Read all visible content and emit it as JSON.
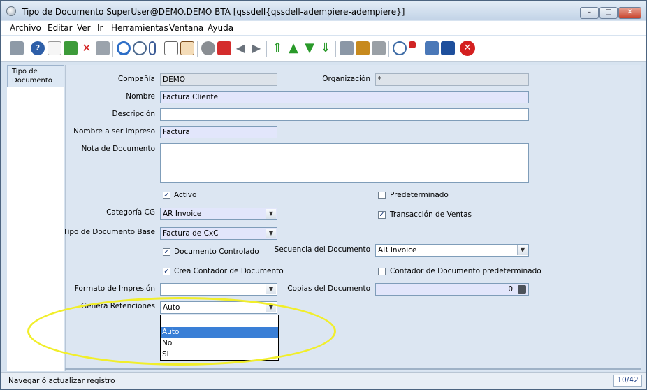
{
  "window": {
    "title": "Tipo de Documento  SuperUser@DEMO.DEMO BTA [qssdell{qssdell-adempiere-adempiere}]",
    "min_label": "–",
    "max_label": "□",
    "close_label": "✕"
  },
  "menu": [
    "Archivo",
    "Editar",
    "Ver",
    "Ir",
    "Herramientas",
    "Ventana",
    "Ayuda"
  ],
  "toolbar": {
    "icons": [
      "undo-icon",
      "help-icon",
      "new-icon",
      "save-new-icon",
      "delete-icon",
      "save-icon",
      "refresh-icon",
      "find-icon",
      "attachment-icon",
      "chat-icon",
      "grid-toggle-icon",
      "history-icon",
      "home-icon",
      "previous-icon",
      "next-icon",
      "first-record-icon",
      "previous-record-icon",
      "next-record-icon",
      "last-record-icon",
      "report-icon",
      "archive-icon",
      "print-icon",
      "zoom-across-icon",
      "request-icon",
      "product-info-icon",
      "workflow-icon",
      "exit-icon"
    ]
  },
  "tab": {
    "label": "Tipo de Documento"
  },
  "fields": {
    "compania": {
      "label": "Compañía",
      "value": "DEMO"
    },
    "organizacion": {
      "label": "Organización",
      "value": "*"
    },
    "nombre": {
      "label": "Nombre",
      "value": "Factura Cliente"
    },
    "descripcion": {
      "label": "Descripción",
      "value": ""
    },
    "nombre_impreso": {
      "label": "Nombre a ser Impreso",
      "value": "Factura"
    },
    "nota_documento": {
      "label": "Nota de Documento",
      "value": ""
    },
    "activo": {
      "label": "Activo",
      "checked": true
    },
    "predeterminado": {
      "label": "Predeterminado",
      "checked": false
    },
    "categoria_cg": {
      "label": "Categoría CG",
      "value": "AR Invoice"
    },
    "transaccion_ventas": {
      "label": "Transacción de Ventas",
      "checked": true
    },
    "tipo_doc_base": {
      "label": "Tipo de Documento Base",
      "value": "Factura de CxC"
    },
    "doc_controlado": {
      "label": "Documento Controlado",
      "checked": true
    },
    "secuencia_doc": {
      "label": "Secuencia del Documento",
      "value": "AR Invoice"
    },
    "crea_contador": {
      "label": "Crea Contador de Documento",
      "checked": true
    },
    "contador_predet": {
      "label": "Contador de Documento predeterminado",
      "checked": false
    },
    "formato_impresion": {
      "label": "Formato de Impresión",
      "value": ""
    },
    "copias_doc": {
      "label": "Copias del Documento",
      "value": "0"
    },
    "genera_retenciones": {
      "label": "Genera Retenciones",
      "value": "Auto",
      "options": [
        "Auto",
        "No",
        "Si"
      ]
    }
  },
  "status": {
    "text": "Navegar ó actualizar registro",
    "record": "10/42"
  },
  "colors": {
    "highlight_oval": "#f1ee2a",
    "selection": "#3a7fd6"
  }
}
